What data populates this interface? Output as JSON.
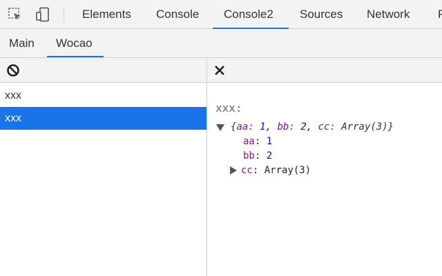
{
  "toolbar": {
    "icons": [
      "inspect-element-icon",
      "device-toolbar-icon"
    ]
  },
  "top_tabs": [
    {
      "label": "Elements",
      "active": false
    },
    {
      "label": "Console",
      "active": false
    },
    {
      "label": "Console2",
      "active": true
    },
    {
      "label": "Sources",
      "active": false
    },
    {
      "label": "Network",
      "active": false
    },
    {
      "label": "P",
      "active": false
    }
  ],
  "sub_tabs": [
    {
      "label": "Main",
      "active": false
    },
    {
      "label": "Wocao",
      "active": true
    }
  ],
  "left_pane": {
    "clear_icon": "clear-console-icon",
    "items": [
      {
        "label": "xxx",
        "selected": false
      },
      {
        "label": "xxx",
        "selected": true
      }
    ]
  },
  "right_pane": {
    "close_icon": "close-icon",
    "log_label": "xxx:",
    "object": {
      "preview_open": "{",
      "preview_aa_key": "aa:",
      "preview_aa_val": "1,",
      "preview_bb_key": "bb:",
      "preview_bb_val": "2,",
      "preview_cc_key": "cc:",
      "preview_cc_val": "Array(3)}",
      "props": [
        {
          "key": "aa",
          "sep": ":",
          "value": "1"
        },
        {
          "key": "bb",
          "sep": ":",
          "value": "2"
        },
        {
          "key": "cc",
          "sep": ":",
          "value": "Array(3)"
        }
      ]
    }
  },
  "colors": {
    "accent": "#1a73e8",
    "key": "#881391",
    "number": "#1c00cf",
    "toolbar_bg": "#f3f3f3"
  }
}
